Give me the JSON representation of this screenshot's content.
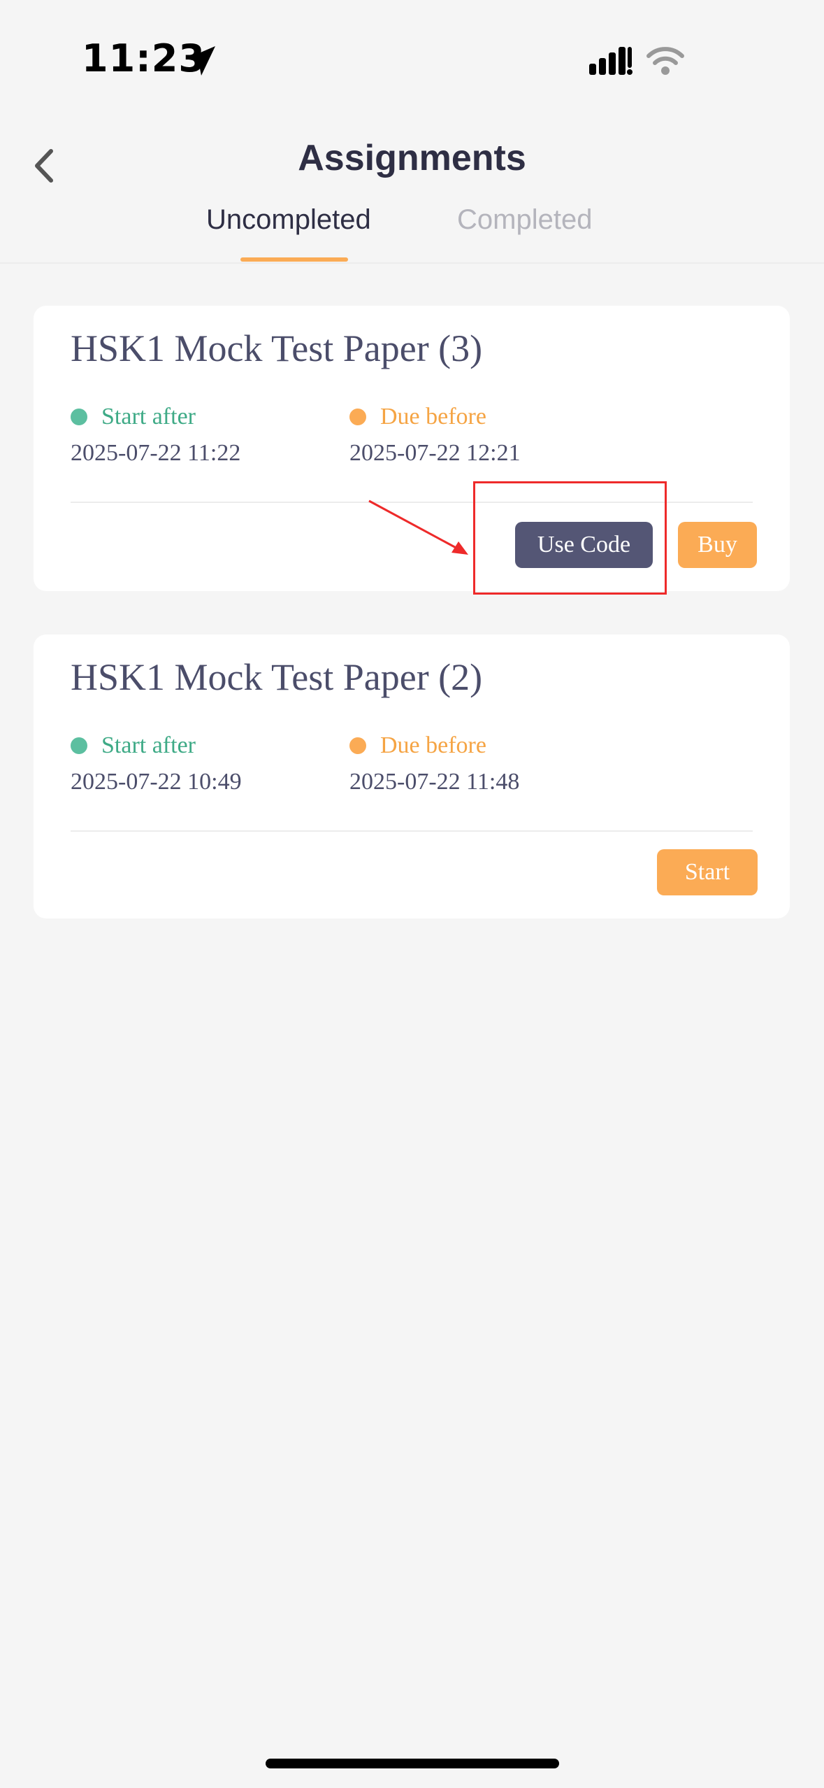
{
  "status_bar": {
    "time": "11:23",
    "icons": [
      "location-arrow-icon",
      "cellular-signal-icon",
      "wifi-icon"
    ]
  },
  "header": {
    "back_icon": "chevron-left-icon",
    "title": "Assignments",
    "tabs": [
      {
        "label": "Uncompleted",
        "active": true
      },
      {
        "label": "Completed",
        "active": false
      }
    ]
  },
  "assignments": [
    {
      "title": "HSK1 Mock Test Paper (3)",
      "start_label": "Start after",
      "start_date": "2025-07-22 11:22",
      "due_label": "Due before",
      "due_date": "2025-07-22 12:21",
      "actions": [
        "Use Code",
        "Buy"
      ]
    },
    {
      "title": "HSK1 Mock Test Paper (2)",
      "start_label": "Start after",
      "start_date": "2025-07-22 10:49",
      "due_label": "Due before",
      "due_date": "2025-07-22 11:48",
      "actions": [
        "Start"
      ]
    }
  ],
  "colors": {
    "accent_orange": "#fbab55",
    "start_green": "#5cbfa0",
    "dark_button": "#545675",
    "title_text": "#2e2e44",
    "annotation_red": "#ee2a2a"
  }
}
